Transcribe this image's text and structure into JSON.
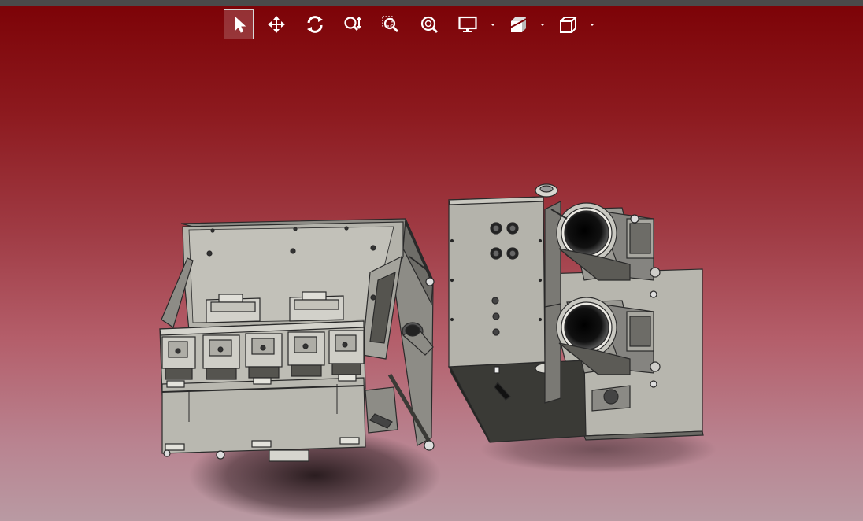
{
  "toolbar": {
    "tools": [
      {
        "id": "select",
        "icon": "cursor-arrow-icon",
        "active": true
      },
      {
        "id": "pan",
        "icon": "move-arrows-icon",
        "active": false
      },
      {
        "id": "rotate",
        "icon": "rotate-icon",
        "active": false
      },
      {
        "id": "zoom",
        "icon": "zoom-updown-icon",
        "active": false
      },
      {
        "id": "zoom-window",
        "icon": "zoom-window-icon",
        "active": false
      },
      {
        "id": "zoom-fit",
        "icon": "zoom-fit-icon",
        "active": false
      },
      {
        "id": "display-mode",
        "icon": "monitor-icon",
        "active": false,
        "dropdown": true
      },
      {
        "id": "section-view",
        "icon": "section-view-icon",
        "active": false,
        "dropdown": true
      },
      {
        "id": "view-orientation",
        "icon": "cube-view-icon",
        "active": false,
        "dropdown": true
      }
    ]
  },
  "colors": {
    "background_top": "#7c0206",
    "background_bottom": "#b99aa3",
    "toolbar_icon": "#ffffff",
    "model_face": "#b4b3ab",
    "model_edge": "#2a2a2a",
    "model_dark": "#3a3a36"
  }
}
